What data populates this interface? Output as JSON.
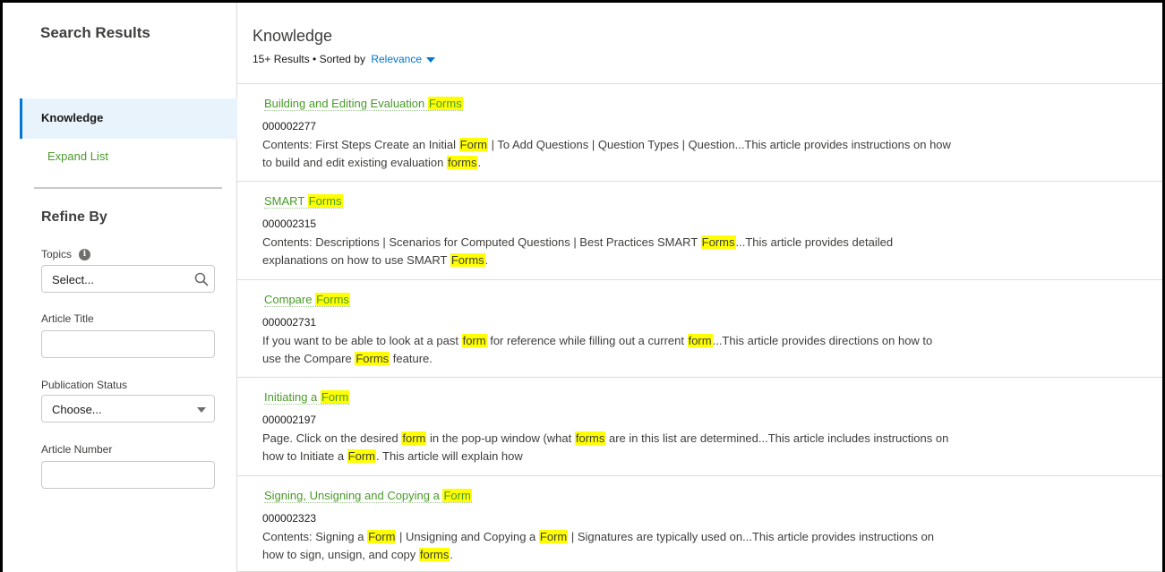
{
  "sidebar": {
    "title": "Search Results",
    "active_item": "Knowledge",
    "expand_link": "Expand List",
    "refine_title": "Refine By",
    "topics": {
      "label": "Topics",
      "placeholder": "Select..."
    },
    "article_title": {
      "label": "Article Title",
      "value": ""
    },
    "publication_status": {
      "label": "Publication Status",
      "value": "Choose..."
    },
    "article_number": {
      "label": "Article Number",
      "value": ""
    }
  },
  "main": {
    "title": "Knowledge",
    "results_count": "15+ Results",
    "sorted_by_label": "Sorted by",
    "sort_value": "Relevance"
  },
  "results": [
    {
      "title_parts": [
        {
          "t": "Building and Editing Evaluation ",
          "h": false
        },
        {
          "t": "Forms",
          "h": true
        }
      ],
      "number": "000002277",
      "summary_parts": [
        {
          "t": "Contents: First Steps Create an Initial ",
          "h": false
        },
        {
          "t": "Form",
          "h": true
        },
        {
          "t": " | To Add Questions | Question Types | Question...This article provides instructions on how to build and edit existing evaluation ",
          "h": false
        },
        {
          "t": "forms",
          "h": true
        },
        {
          "t": ".",
          "h": false
        }
      ]
    },
    {
      "title_parts": [
        {
          "t": "SMART ",
          "h": false
        },
        {
          "t": "Forms",
          "h": true
        }
      ],
      "number": "000002315",
      "summary_parts": [
        {
          "t": "Contents: Descriptions | Scenarios for Computed Questions | Best Practices SMART ",
          "h": false
        },
        {
          "t": "Forms",
          "h": true
        },
        {
          "t": "...This article provides detailed explanations on how to use SMART ",
          "h": false
        },
        {
          "t": "Forms",
          "h": true
        },
        {
          "t": ".",
          "h": false
        }
      ]
    },
    {
      "title_parts": [
        {
          "t": "Compare ",
          "h": false
        },
        {
          "t": "Forms",
          "h": true
        }
      ],
      "number": "000002731",
      "summary_parts": [
        {
          "t": "If you want to be able to look at a past ",
          "h": false
        },
        {
          "t": "form",
          "h": true
        },
        {
          "t": " for reference while filling out a current ",
          "h": false
        },
        {
          "t": "form",
          "h": true
        },
        {
          "t": "...This article provides directions on how to use the Compare ",
          "h": false
        },
        {
          "t": "Forms",
          "h": true
        },
        {
          "t": " feature.",
          "h": false
        }
      ]
    },
    {
      "title_parts": [
        {
          "t": "Initiating a ",
          "h": false
        },
        {
          "t": "Form",
          "h": true
        }
      ],
      "number": "000002197",
      "summary_parts": [
        {
          "t": "Page. Click on the desired ",
          "h": false
        },
        {
          "t": "form",
          "h": true
        },
        {
          "t": " in the pop-up window (what ",
          "h": false
        },
        {
          "t": "forms",
          "h": true
        },
        {
          "t": " are in this list are determined...This article includes instructions on how to Initiate a ",
          "h": false
        },
        {
          "t": "Form",
          "h": true
        },
        {
          "t": ". This article will explain how",
          "h": false
        }
      ]
    },
    {
      "title_parts": [
        {
          "t": "Signing, Unsigning and Copying a ",
          "h": false
        },
        {
          "t": "Form",
          "h": true
        }
      ],
      "number": "000002323",
      "summary_parts": [
        {
          "t": "Contents: Signing a ",
          "h": false
        },
        {
          "t": "Form",
          "h": true
        },
        {
          "t": " | Unsigning and Copying a ",
          "h": false
        },
        {
          "t": "Form",
          "h": true
        },
        {
          "t": " | Signatures are typically used on...This article provides instructions on how to sign, unsign, and copy ",
          "h": false
        },
        {
          "t": "forms",
          "h": true
        },
        {
          "t": ".",
          "h": false
        }
      ]
    }
  ]
}
